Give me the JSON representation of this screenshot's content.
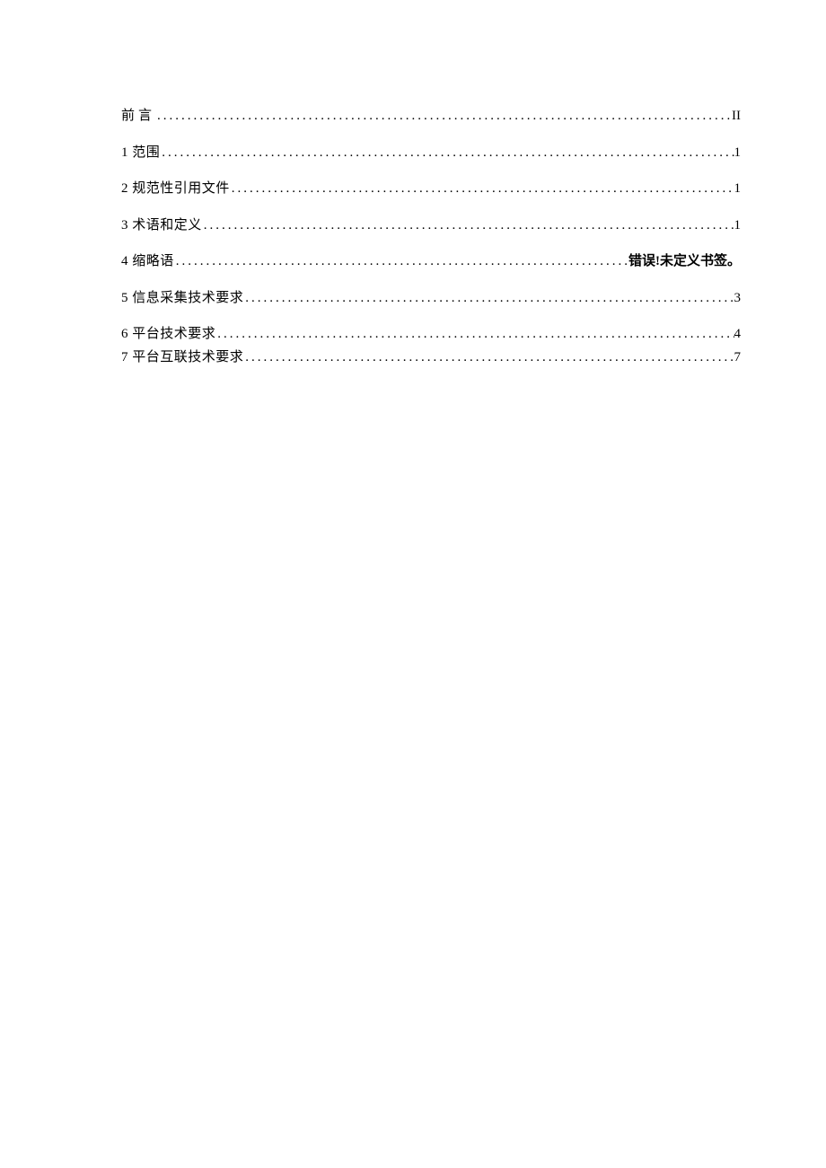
{
  "toc": {
    "entries": [
      {
        "label": "前言",
        "page": "II",
        "spaced": true,
        "error": false,
        "tight": false
      },
      {
        "label": "1 范围",
        "page": "1",
        "spaced": false,
        "error": false,
        "tight": false
      },
      {
        "label": "2 规范性引用文件",
        "page": "1",
        "spaced": false,
        "error": false,
        "tight": false
      },
      {
        "label": "3 术语和定义",
        "page": "1",
        "spaced": false,
        "error": false,
        "tight": false
      },
      {
        "label": "4 缩略语",
        "page": "错误!未定义书签。",
        "spaced": false,
        "error": true,
        "tight": false
      },
      {
        "label": "5 信息采集技术要求",
        "page": "3",
        "spaced": false,
        "error": false,
        "tight": false
      },
      {
        "label": "6 平台技术要求",
        "page": "4",
        "spaced": false,
        "error": false,
        "tight": true
      },
      {
        "label": "7 平台互联技术要求",
        "page": "7",
        "spaced": false,
        "error": false,
        "tight": false
      }
    ]
  }
}
